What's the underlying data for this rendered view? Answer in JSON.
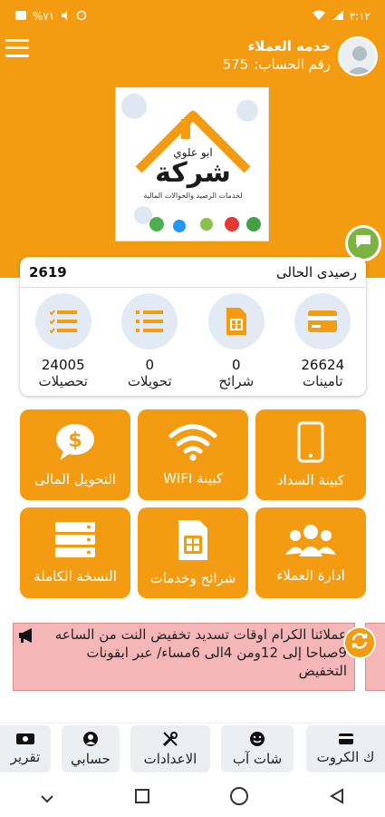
{
  "status_bar": {
    "time": "٣:١٢",
    "battery": "%٧١"
  },
  "header": {
    "user_name": "خدمه العملاء",
    "account_label": "رقم الحساب:",
    "account_number": "575"
  },
  "logo": {
    "text_top": "ابو علوي",
    "text_main": "شركة",
    "subtitle": "لخدمات الرصيد والحوالات المالية"
  },
  "balance": {
    "label": "رصيدى الحالى",
    "value": "2619"
  },
  "stats": [
    {
      "label": "تامينات",
      "value": "26624",
      "icon": "card-icon"
    },
    {
      "label": "شرائح",
      "value": "0",
      "icon": "sim-icon"
    },
    {
      "label": "تحويلات",
      "value": "0",
      "icon": "list-icon"
    },
    {
      "label": "تحصيلات",
      "value": "24005",
      "icon": "checklist-icon"
    }
  ],
  "tiles": [
    {
      "label": "كبينة السداد",
      "icon": "phone-icon"
    },
    {
      "label": "كبينة WIFI",
      "icon": "wifi-icon"
    },
    {
      "label": "التحويل المالى",
      "icon": "dollar-chat-icon"
    },
    {
      "label": "ادارة العملاء",
      "icon": "users-icon"
    },
    {
      "label": "شرائح وخدمات",
      "icon": "sim-icon"
    },
    {
      "label": "النسخة الكاملة",
      "icon": "server-icon"
    }
  ],
  "ticker": {
    "text": "عملائنا الكرام اوقات تسديد تخفيض النت من الساعه 9صباحا إلى 12ومن 4الى 6مساء/ عبر ابقونات التخفيض"
  },
  "bottom_nav": [
    {
      "label": "ك الكروت",
      "icon": "card-icon"
    },
    {
      "label": "شات آب",
      "icon": "smile-icon"
    },
    {
      "label": "الاعدادات",
      "icon": "tools-icon"
    },
    {
      "label": "حسابي",
      "icon": "user-icon"
    },
    {
      "label": "تقرير",
      "icon": "money-icon"
    }
  ],
  "colors": {
    "accent": "#f39c12",
    "tile": "#f39c12",
    "ticker_bg": "#f4b6b6",
    "chat_fab": "#7cb342"
  }
}
